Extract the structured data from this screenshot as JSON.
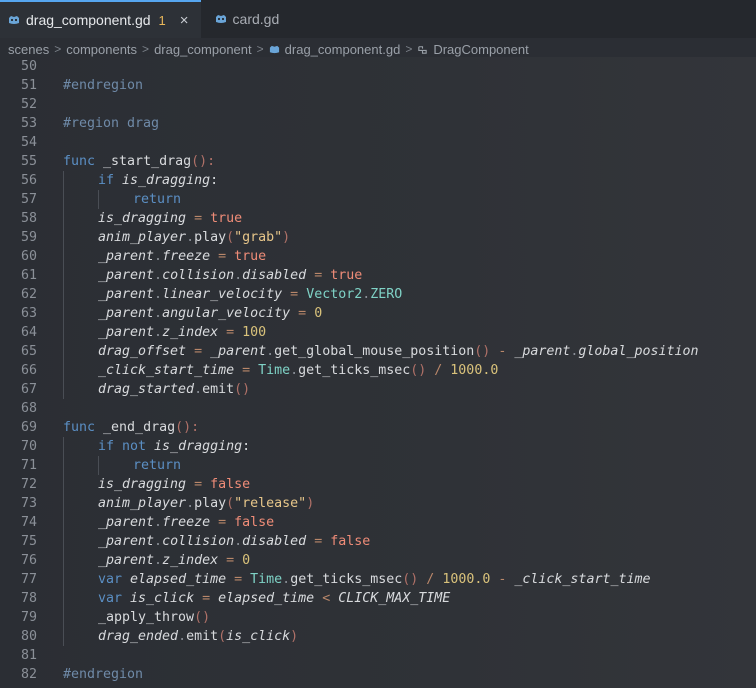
{
  "tabs": [
    {
      "label": "drag_component.gd",
      "badge": "1",
      "active": true,
      "icon": "godot-icon"
    },
    {
      "label": "card.gd",
      "badge": "",
      "active": false,
      "icon": "godot-icon"
    }
  ],
  "tab_close": "×",
  "breadcrumb": {
    "items": [
      "scenes",
      "components",
      "drag_component",
      "drag_component.gd",
      "DragComponent"
    ],
    "separator": ">"
  },
  "code_lines": [
    {
      "n": "50",
      "indent": 0,
      "tokens": []
    },
    {
      "n": "51",
      "indent": 0,
      "tokens": [
        [
          "cm",
          "#endregion"
        ]
      ]
    },
    {
      "n": "52",
      "indent": 0,
      "tokens": []
    },
    {
      "n": "53",
      "indent": 0,
      "tokens": [
        [
          "cm",
          "#region drag"
        ]
      ]
    },
    {
      "n": "54",
      "indent": 0,
      "tokens": []
    },
    {
      "n": "55",
      "indent": 0,
      "tokens": [
        [
          "kw",
          "func"
        ],
        [
          "fn",
          " _start_drag"
        ],
        [
          "pn",
          "():"
        ]
      ]
    },
    {
      "n": "56",
      "indent": 1,
      "tokens": [
        [
          "kw",
          "if "
        ],
        [
          "id",
          "is_dragging"
        ],
        [
          "fn",
          ":"
        ]
      ]
    },
    {
      "n": "57",
      "indent": 2,
      "tokens": [
        [
          "kw",
          "return"
        ]
      ]
    },
    {
      "n": "58",
      "indent": 1,
      "tokens": [
        [
          "id",
          "is_dragging"
        ],
        [
          "op",
          " = "
        ],
        [
          "bool",
          "true"
        ]
      ]
    },
    {
      "n": "59",
      "indent": 1,
      "tokens": [
        [
          "id",
          "anim_player"
        ],
        [
          "dot",
          "."
        ],
        [
          "mth",
          "play"
        ],
        [
          "pn",
          "("
        ],
        [
          "str",
          "\"grab\""
        ],
        [
          "pn",
          ")"
        ]
      ]
    },
    {
      "n": "60",
      "indent": 1,
      "tokens": [
        [
          "id",
          "_parent"
        ],
        [
          "dot",
          "."
        ],
        [
          "pr",
          "freeze"
        ],
        [
          "op",
          " = "
        ],
        [
          "bool",
          "true"
        ]
      ]
    },
    {
      "n": "61",
      "indent": 1,
      "tokens": [
        [
          "id",
          "_parent"
        ],
        [
          "dot",
          "."
        ],
        [
          "pr",
          "collision"
        ],
        [
          "dot",
          "."
        ],
        [
          "pr",
          "disabled"
        ],
        [
          "op",
          " = "
        ],
        [
          "bool",
          "true"
        ]
      ]
    },
    {
      "n": "62",
      "indent": 1,
      "tokens": [
        [
          "id",
          "_parent"
        ],
        [
          "dot",
          "."
        ],
        [
          "pr",
          "linear_velocity"
        ],
        [
          "op",
          " = "
        ],
        [
          "cls",
          "Vector2"
        ],
        [
          "dot",
          "."
        ],
        [
          "cls",
          "ZERO"
        ]
      ]
    },
    {
      "n": "63",
      "indent": 1,
      "tokens": [
        [
          "id",
          "_parent"
        ],
        [
          "dot",
          "."
        ],
        [
          "pr",
          "angular_velocity"
        ],
        [
          "op",
          " = "
        ],
        [
          "num",
          "0"
        ]
      ]
    },
    {
      "n": "64",
      "indent": 1,
      "tokens": [
        [
          "id",
          "_parent"
        ],
        [
          "dot",
          "."
        ],
        [
          "pr",
          "z_index"
        ],
        [
          "op",
          " = "
        ],
        [
          "num",
          "100"
        ]
      ]
    },
    {
      "n": "65",
      "indent": 1,
      "tokens": [
        [
          "id",
          "drag_offset"
        ],
        [
          "op",
          " = "
        ],
        [
          "id",
          "_parent"
        ],
        [
          "dot",
          "."
        ],
        [
          "mth",
          "get_global_mouse_position"
        ],
        [
          "pn",
          "()"
        ],
        [
          "op",
          " - "
        ],
        [
          "id",
          "_parent"
        ],
        [
          "dot",
          "."
        ],
        [
          "pr",
          "global_position"
        ]
      ]
    },
    {
      "n": "66",
      "indent": 1,
      "tokens": [
        [
          "id",
          "_click_start_time"
        ],
        [
          "op",
          " = "
        ],
        [
          "cls",
          "Time"
        ],
        [
          "dot",
          "."
        ],
        [
          "mth",
          "get_ticks_msec"
        ],
        [
          "pn",
          "()"
        ],
        [
          "op",
          " / "
        ],
        [
          "num",
          "1000.0"
        ]
      ]
    },
    {
      "n": "67",
      "indent": 1,
      "tokens": [
        [
          "id",
          "drag_started"
        ],
        [
          "dot",
          "."
        ],
        [
          "mth",
          "emit"
        ],
        [
          "pn",
          "()"
        ]
      ]
    },
    {
      "n": "68",
      "indent": 0,
      "tokens": []
    },
    {
      "n": "69",
      "indent": 0,
      "tokens": [
        [
          "kw",
          "func"
        ],
        [
          "fn",
          " _end_drag"
        ],
        [
          "pn",
          "():"
        ]
      ]
    },
    {
      "n": "70",
      "indent": 1,
      "tokens": [
        [
          "kw",
          "if not "
        ],
        [
          "id",
          "is_dragging"
        ],
        [
          "fn",
          ":"
        ]
      ]
    },
    {
      "n": "71",
      "indent": 2,
      "tokens": [
        [
          "kw",
          "return"
        ]
      ]
    },
    {
      "n": "72",
      "indent": 1,
      "tokens": [
        [
          "id",
          "is_dragging"
        ],
        [
          "op",
          " = "
        ],
        [
          "bool",
          "false"
        ]
      ]
    },
    {
      "n": "73",
      "indent": 1,
      "tokens": [
        [
          "id",
          "anim_player"
        ],
        [
          "dot",
          "."
        ],
        [
          "mth",
          "play"
        ],
        [
          "pn",
          "("
        ],
        [
          "str",
          "\"release\""
        ],
        [
          "pn",
          ")"
        ]
      ]
    },
    {
      "n": "74",
      "indent": 1,
      "tokens": [
        [
          "id",
          "_parent"
        ],
        [
          "dot",
          "."
        ],
        [
          "pr",
          "freeze"
        ],
        [
          "op",
          " = "
        ],
        [
          "bool",
          "false"
        ]
      ]
    },
    {
      "n": "75",
      "indent": 1,
      "tokens": [
        [
          "id",
          "_parent"
        ],
        [
          "dot",
          "."
        ],
        [
          "pr",
          "collision"
        ],
        [
          "dot",
          "."
        ],
        [
          "pr",
          "disabled"
        ],
        [
          "op",
          " = "
        ],
        [
          "bool",
          "false"
        ]
      ]
    },
    {
      "n": "76",
      "indent": 1,
      "tokens": [
        [
          "id",
          "_parent"
        ],
        [
          "dot",
          "."
        ],
        [
          "pr",
          "z_index"
        ],
        [
          "op",
          " = "
        ],
        [
          "num",
          "0"
        ]
      ]
    },
    {
      "n": "77",
      "indent": 1,
      "tokens": [
        [
          "kw",
          "var "
        ],
        [
          "id",
          "elapsed_time"
        ],
        [
          "op",
          " = "
        ],
        [
          "cls",
          "Time"
        ],
        [
          "dot",
          "."
        ],
        [
          "mth",
          "get_ticks_msec"
        ],
        [
          "pn",
          "()"
        ],
        [
          "op",
          " / "
        ],
        [
          "num",
          "1000.0"
        ],
        [
          "op",
          " - "
        ],
        [
          "id",
          "_click_start_time"
        ]
      ]
    },
    {
      "n": "78",
      "indent": 1,
      "tokens": [
        [
          "kw",
          "var "
        ],
        [
          "id",
          "is_click"
        ],
        [
          "op",
          " = "
        ],
        [
          "id",
          "elapsed_time"
        ],
        [
          "op",
          " < "
        ],
        [
          "id",
          "CLICK_MAX_TIME"
        ]
      ]
    },
    {
      "n": "79",
      "indent": 1,
      "tokens": [
        [
          "fn",
          "_apply_throw"
        ],
        [
          "pn",
          "()"
        ]
      ]
    },
    {
      "n": "80",
      "indent": 1,
      "tokens": [
        [
          "id",
          "drag_ended"
        ],
        [
          "dot",
          "."
        ],
        [
          "mth",
          "emit"
        ],
        [
          "pn",
          "("
        ],
        [
          "id",
          "is_click"
        ],
        [
          "pn",
          ")"
        ]
      ]
    },
    {
      "n": "81",
      "indent": 0,
      "tokens": []
    },
    {
      "n": "82",
      "indent": 0,
      "tokens": [
        [
          "cm",
          "#endregion"
        ]
      ]
    }
  ]
}
